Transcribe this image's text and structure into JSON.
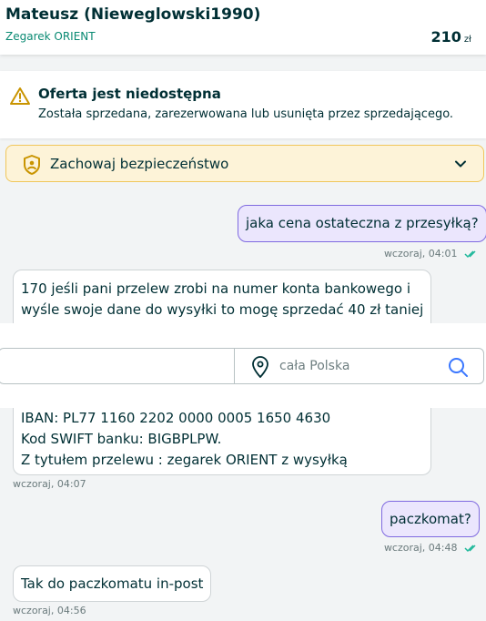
{
  "header": {
    "seller": "Mateusz (Nieweglowski1990)",
    "item": "Zegarek ORIENT",
    "price": "210",
    "currency": "zł"
  },
  "notice": {
    "title": "Oferta jest niedostępna",
    "text": "Została sprzedana, zarezerwowana lub usunięta przez sprzedającego."
  },
  "safety": {
    "label": "Zachowaj bezpieczeństwo"
  },
  "search": {
    "location_placeholder": "cała Polska"
  },
  "messages": [
    {
      "direction": "out",
      "text": "jaka cena ostateczna z przesyłką?",
      "time": "wczoraj, 04:01",
      "read": true
    },
    {
      "direction": "in",
      "lines": [
        "170 jeśli pani przelew zrobi na numer konta bankowego i",
        "wyśle swoje dane do wysyłki to mogę sprzedać 40 zł taniej"
      ]
    },
    {
      "direction": "in",
      "lines": [
        "IBAN: PL77 1160 2202 0000 0005 1650 4630",
        "Kod SWIFT banku: BIGBPLPW.",
        "Z tytułem przelewu : zegarek ORIENT z wysyłką"
      ],
      "time": "wczoraj, 04:07"
    },
    {
      "direction": "out",
      "text": "paczkomat?",
      "time": "wczoraj, 04:48",
      "read": true
    },
    {
      "direction": "in",
      "text": "Tak do paczkomatu in-post",
      "time": "wczoraj, 04:56"
    }
  ],
  "colors": {
    "accent": "#7f6ae0",
    "outgoing_bubble": "#ebe6fd",
    "teal_link": "#0a8a73",
    "warning": "#f0c65a"
  }
}
